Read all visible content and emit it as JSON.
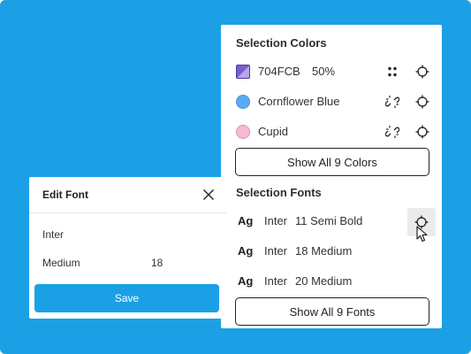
{
  "selection_panel": {
    "colors_title": "Selection Colors",
    "colors": [
      {
        "label": "704FCB",
        "opacity": "50%",
        "swatch": "#7a5ccb",
        "style": "square",
        "action_icon": "style-dots-icon",
        "target_icon": "target-icon"
      },
      {
        "label": "Cornflower Blue",
        "swatch": "#5aaaf5",
        "style": "circle",
        "action_icon": "detach-link-icon",
        "target_icon": "target-icon"
      },
      {
        "label": "Cupid",
        "swatch": "#f7b8d4",
        "style": "circle",
        "action_icon": "detach-link-icon",
        "target_icon": "target-icon"
      }
    ],
    "show_all_colors": "Show All 9 Colors",
    "fonts_title": "Selection Fonts",
    "fonts": [
      {
        "ag": "Ag",
        "family": "Inter",
        "spec": "11 Semi Bold",
        "target_icon": "target-icon",
        "hovered": true
      },
      {
        "ag": "Ag",
        "family": "Inter",
        "spec": "18 Medium"
      },
      {
        "ag": "Ag",
        "family": "Inter",
        "spec": "20 Medium"
      }
    ],
    "show_all_fonts": "Show All 9 Fonts"
  },
  "edit_font_modal": {
    "title": "Edit Font",
    "family": "Inter",
    "weight": "Medium",
    "size": "18",
    "save_label": "Save"
  },
  "colors": {
    "accent": "#1ba0e6",
    "background": "#1ba0e6",
    "panel": "#ffffff",
    "text": "#333333"
  }
}
